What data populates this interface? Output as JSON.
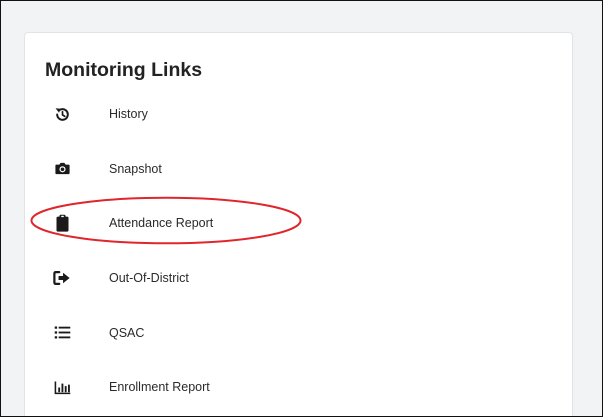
{
  "card": {
    "title": "Monitoring Links"
  },
  "links": [
    {
      "label": "History",
      "icon": "history-icon"
    },
    {
      "label": "Snapshot",
      "icon": "camera-icon"
    },
    {
      "label": "Attendance Report",
      "icon": "clipboard-icon"
    },
    {
      "label": "Out-Of-District",
      "icon": "sign-out-icon"
    },
    {
      "label": "QSAC",
      "icon": "list-icon"
    },
    {
      "label": "Enrollment Report",
      "icon": "bar-chart-icon"
    }
  ],
  "annotation": {
    "color": "#e0262c",
    "highlighted_link": "Attendance Report"
  },
  "colors": {
    "page_background": "#f2f3f5",
    "card_background": "#ffffff",
    "text": "#2a2a2a",
    "icon": "#1a1a1a"
  }
}
